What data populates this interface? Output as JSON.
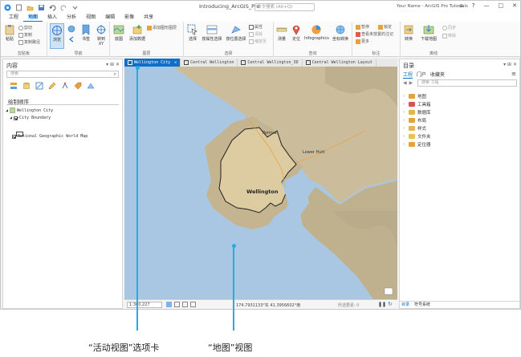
{
  "app": {
    "window_title": "Introducing_ArcGIS_Pro",
    "command_search_placeholder": "命令搜索 (Alt+Q)",
    "user_label": "Your Name - ArcGIS Pro Tutorials",
    "window_buttons": [
      "?",
      "—",
      "□",
      "✕"
    ]
  },
  "ribbon_tabs": [
    "工程",
    "地图",
    "插入",
    "分析",
    "视图",
    "编辑",
    "影像",
    "共享"
  ],
  "active_ribbon_tab": "地图",
  "ribbon": {
    "clipboard": {
      "group": "剪贴板",
      "paste": "粘贴",
      "cut": "剪切",
      "copy": "复制",
      "copy_path": "复制路径"
    },
    "navigate": {
      "group": "导航",
      "explore": "浏览",
      "bookmarks": "书签",
      "go_to": "转到 XY"
    },
    "layer": {
      "group": "图层",
      "basemap": "底图",
      "add_data": "添加数据",
      "add_graphics": "添加图形图层"
    },
    "selection": {
      "group": "选择",
      "select": "选择",
      "by_attributes": "按属性选择",
      "by_location": "按位置选择",
      "attributes": "属性",
      "clear": "清除",
      "zoom_to": "缩放至"
    },
    "inquiry": {
      "group": "查询",
      "measure": "测量",
      "locate": "定位",
      "infographics": "Infographics",
      "coordinate_conversion": "坐标转换"
    },
    "labeling": {
      "group": "标注",
      "pause": "暂停",
      "lock": "锁定",
      "view_unplaced": "查看未放置的注记",
      "more": "更多"
    },
    "offline": {
      "group": "离线",
      "convert": "转换",
      "download_map": "下载地图",
      "sync": "同步",
      "remove": "移除"
    }
  },
  "contents_pane": {
    "title": "内容",
    "search_placeholder": "搜索",
    "drawing_order": "绘制顺序",
    "map": "Wellington City",
    "layers": [
      "City Boundary",
      "National Geographic World Map"
    ]
  },
  "view_tabs": [
    {
      "label": "Wellington City",
      "active": true
    },
    {
      "label": "Central Wellington",
      "active": false
    },
    {
      "label": "Central Wellington_3D",
      "active": false
    },
    {
      "label": "Central Wellington Layout",
      "active": false
    }
  ],
  "map": {
    "labels": {
      "porirua": "Porirua",
      "lower_hutt": "Lower Hutt",
      "wellington": "Wellington"
    },
    "colors": {
      "water": "#a9c7e3",
      "land": "#c9b99a",
      "boundary": "#222222",
      "city_fill": "#e8d6a8"
    }
  },
  "map_status": {
    "scale": "1:300,227",
    "coordinates": "174.7931133°东 41.3956602°南",
    "selected_features": "所选要素: 0"
  },
  "catalog_pane": {
    "title": "目录",
    "tabs": [
      "工程",
      "门户",
      "收藏夹"
    ],
    "active_tab": "工程",
    "search_placeholder": "搜索 工程",
    "items": [
      {
        "label": "地图",
        "color": "#e9a23b"
      },
      {
        "label": "工具箱",
        "color": "#d9534f"
      },
      {
        "label": "数据库",
        "color": "#e0b84a"
      },
      {
        "label": "布局",
        "color": "#e9a23b"
      },
      {
        "label": "样式",
        "color": "#e6b35a"
      },
      {
        "label": "文件夹",
        "color": "#f0c04a"
      },
      {
        "label": "定位器",
        "color": "#e9a23b"
      }
    ],
    "bottom_tabs": [
      "目录",
      "符号系统"
    ],
    "active_bottom_tab": "目录"
  },
  "callouts": {
    "active_view_tab": "“活动视图”选项卡",
    "map_view": "“地图”视图"
  },
  "accent": "#0f6fc6",
  "callout_color": "#29abe2"
}
